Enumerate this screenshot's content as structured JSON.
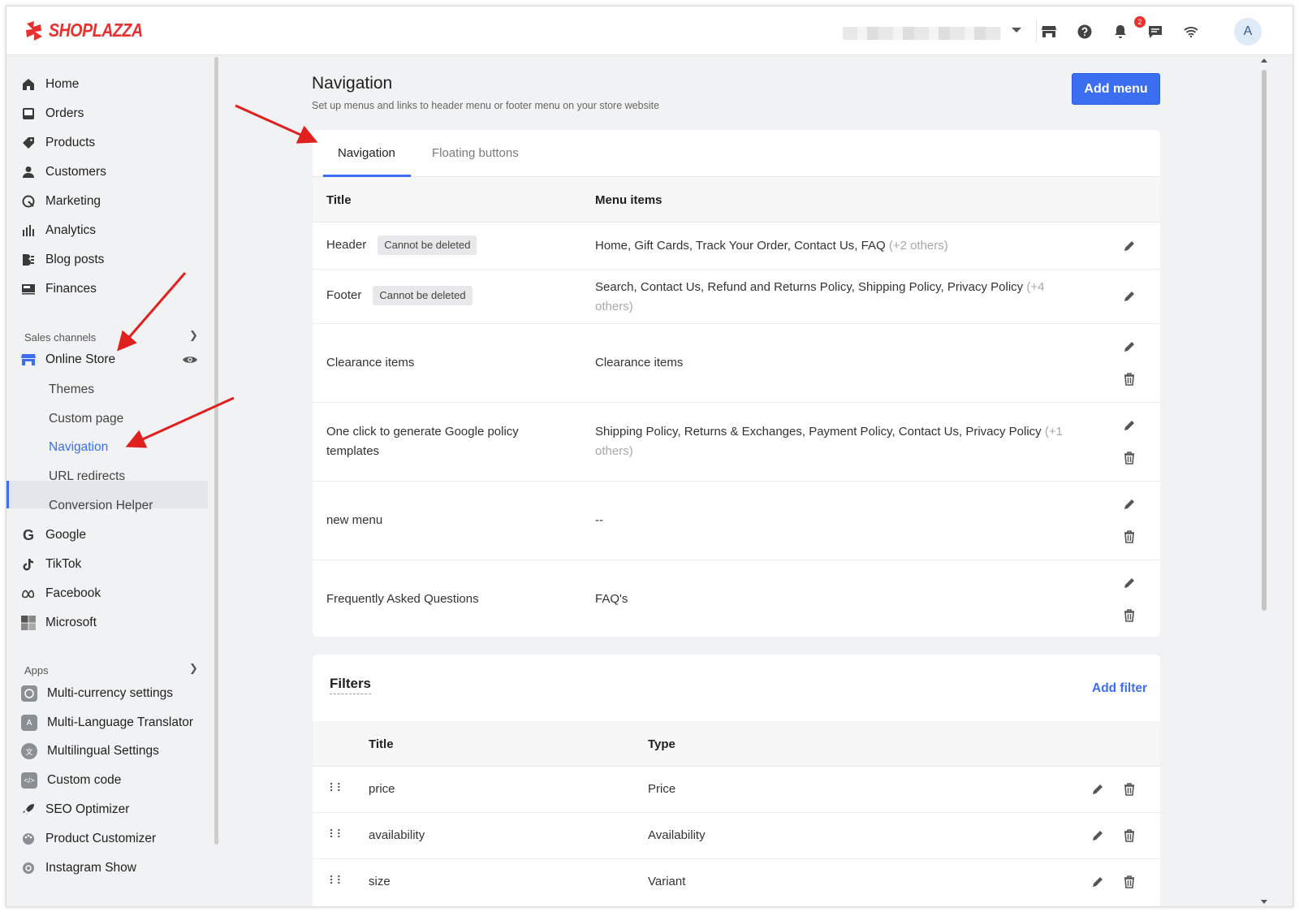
{
  "brand": {
    "name": "SHOPLAZZA",
    "color": "#e8312f"
  },
  "topbar": {
    "icons": [
      "store-icon",
      "help-icon",
      "bell-icon",
      "chat-icon",
      "wifi-icon"
    ],
    "notification_count": "2",
    "avatar_initial": "A"
  },
  "sidebar": {
    "items": [
      {
        "label": "Home",
        "icon": "home-icon"
      },
      {
        "label": "Orders",
        "icon": "orders-icon"
      },
      {
        "label": "Products",
        "icon": "tag-icon"
      },
      {
        "label": "Customers",
        "icon": "user-icon"
      },
      {
        "label": "Marketing",
        "icon": "marketing-icon"
      },
      {
        "label": "Analytics",
        "icon": "chart-icon"
      },
      {
        "label": "Blog posts",
        "icon": "blog-icon"
      },
      {
        "label": "Finances",
        "icon": "finances-icon"
      }
    ],
    "sales_channels_label": "Sales channels",
    "online_store_label": "Online Store",
    "online_store_sub": [
      "Themes",
      "Custom page",
      "Navigation",
      "URL redirects",
      "Conversion Helper"
    ],
    "channels": [
      {
        "label": "Google",
        "icon": "google-icon"
      },
      {
        "label": "TikTok",
        "icon": "tiktok-icon"
      },
      {
        "label": "Facebook",
        "icon": "meta-icon"
      },
      {
        "label": "Microsoft",
        "icon": "microsoft-icon"
      }
    ],
    "apps_label": "Apps",
    "apps": [
      {
        "label": "Multi-currency settings"
      },
      {
        "label": "Multi-Language Translator"
      },
      {
        "label": "Multilingual Settings"
      },
      {
        "label": "Custom code"
      },
      {
        "label": "SEO Optimizer"
      },
      {
        "label": "Product Customizer"
      },
      {
        "label": "Instagram Show"
      }
    ]
  },
  "header": {
    "title": "Navigation",
    "subtitle": "Set up menus and links to header menu or footer menu on your store website",
    "add_menu": "Add menu"
  },
  "tabs": [
    "Navigation",
    "Floating buttons"
  ],
  "menus": {
    "columns": [
      "Title",
      "Menu items"
    ],
    "rows": [
      {
        "title": "Header",
        "tag": "Cannot be deleted",
        "items": "Home, Gift Cards, Track Your Order, Contact Us, FAQ",
        "more": "(+2 others)"
      },
      {
        "title": "Footer",
        "tag": "Cannot be deleted",
        "items": "Search, Contact Us, Refund and Returns Policy, Shipping Policy, Privacy Policy",
        "more": "(+4",
        "more2": "others)"
      },
      {
        "title": "Clearance items",
        "items": "Clearance items"
      },
      {
        "title": "One click to generate Google policy",
        "title2": "templates",
        "items": "Shipping Policy, Returns & Exchanges, Payment Policy, Contact Us, Privacy Policy",
        "more": "(+1",
        "more2": "others)"
      },
      {
        "title": "new menu",
        "items": "--"
      },
      {
        "title": "Frequently Asked Questions",
        "items": "FAQ's"
      }
    ]
  },
  "filters": {
    "title": "Filters",
    "add": "Add filter",
    "columns": [
      "Title",
      "Type"
    ],
    "rows": [
      {
        "title": "price",
        "type": "Price"
      },
      {
        "title": "availability",
        "type": "Availability"
      },
      {
        "title": "size",
        "type": "Variant"
      }
    ]
  },
  "colors": {
    "accent": "#3b6ef0",
    "annotation_arrow": "#e0201e"
  }
}
